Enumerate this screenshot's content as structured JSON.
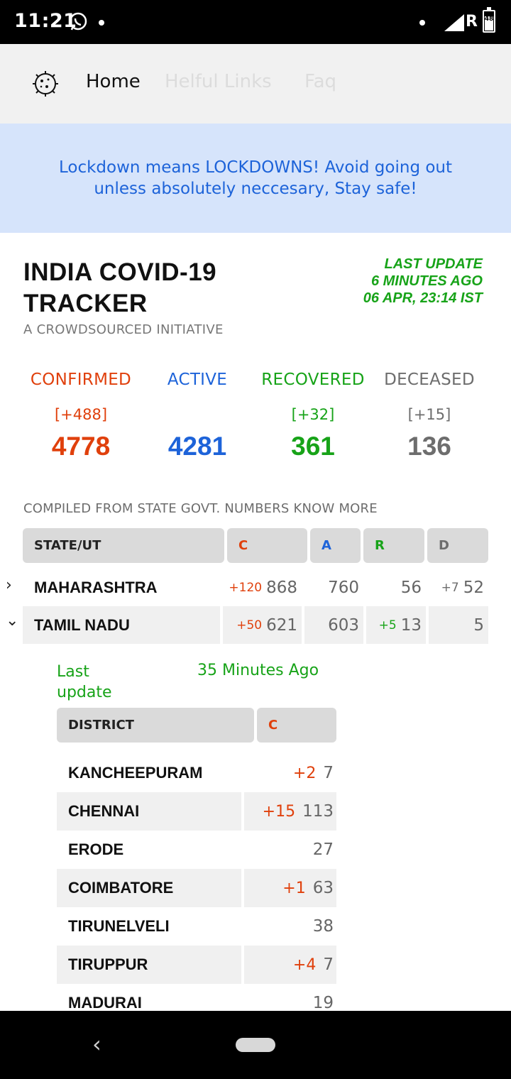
{
  "status_bar": {
    "time": "11:21",
    "network": "R",
    "battery_level": "48"
  },
  "nav": {
    "home": "Home",
    "helpful_links": "Helful Links",
    "faq": "Faq"
  },
  "banner": {
    "text": "Lockdown means LOCKDOWNS! Avoid going out unless absolutely neccesary, Stay safe!"
  },
  "header": {
    "title": "INDIA COVID-19 TRACKER",
    "subtitle": "A CROWDSOURCED INITIATIVE",
    "last_update_label": "LAST UPDATE",
    "last_update_relative": "6 MINUTES AGO",
    "last_update_time": "06 APR, 23:14 IST"
  },
  "stats": {
    "confirmed": {
      "label": "CONFIRMED",
      "delta": "[+488]",
      "value": "4778"
    },
    "active": {
      "label": "ACTIVE",
      "delta": "",
      "value": "4281"
    },
    "recovered": {
      "label": "RECOVERED",
      "delta": "[+32]",
      "value": "361"
    },
    "deceased": {
      "label": "DECEASED",
      "delta": "[+15]",
      "value": "136"
    }
  },
  "compiled_text": "COMPILED FROM STATE GOVT. NUMBERS KNOW MORE",
  "state_table": {
    "headers": {
      "state": "STATE/UT",
      "c": "C",
      "a": "A",
      "r": "R",
      "d": "D"
    },
    "rows": [
      {
        "name": "MAHARASHTRA",
        "c_delta": "+120",
        "c": "868",
        "a": "760",
        "r_delta": "",
        "r": "56",
        "d_delta": "+7",
        "d": "52",
        "expanded": false
      },
      {
        "name": "TAMIL NADU",
        "c_delta": "+50",
        "c": "621",
        "a": "603",
        "r_delta": "+5",
        "r": "13",
        "d_delta": "",
        "d": "5",
        "expanded": true
      }
    ]
  },
  "district_section": {
    "last_update_label": "Last update",
    "last_update_value": "35 Minutes Ago",
    "headers": {
      "district": "DISTRICT",
      "c": "C"
    },
    "rows": [
      {
        "name": "KANCHEEPURAM",
        "delta": "+2",
        "value": "7"
      },
      {
        "name": "CHENNAI",
        "delta": "+15",
        "value": "113"
      },
      {
        "name": "ERODE",
        "delta": "",
        "value": "27"
      },
      {
        "name": "COIMBATORE",
        "delta": "+1",
        "value": "63"
      },
      {
        "name": "TIRUNELVELI",
        "delta": "",
        "value": "38"
      },
      {
        "name": "TIRUPPUR",
        "delta": "+4",
        "value": "7"
      },
      {
        "name": "MADURAI",
        "delta": "",
        "value": "19"
      }
    ]
  },
  "colors": {
    "confirmed": "#e0400c",
    "active": "#1d63d9",
    "recovered": "#17a318",
    "deceased": "#6d6d6d",
    "banner_bg": "#d6e4fb"
  }
}
